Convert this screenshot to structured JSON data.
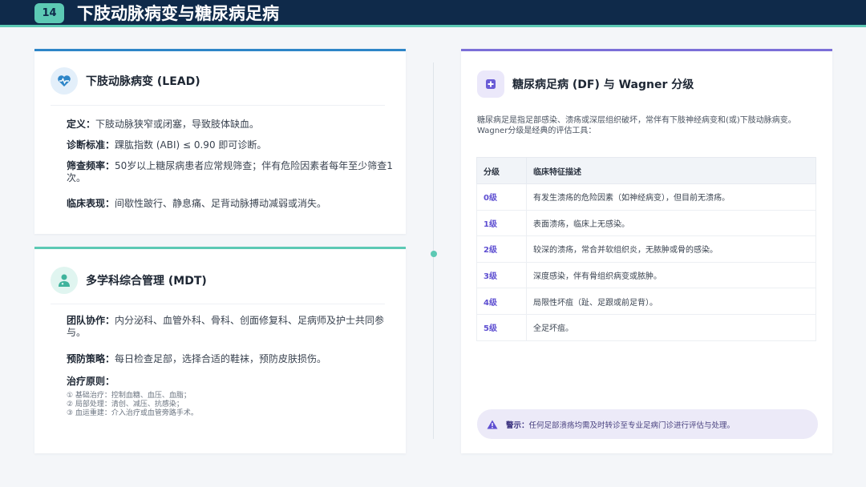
{
  "header": {
    "page_number": "14",
    "title": "下肢动脉病变与糖尿病足病"
  },
  "lead": {
    "title": "下肢动脉病变 (LEAD)",
    "icon": "heartbeat-icon",
    "fields": [
      {
        "label": "定义：",
        "value": "下肢动脉狭窄或闭塞，导致肢体缺血。"
      },
      {
        "label": "诊断标准：",
        "value": "踝肱指数 (ABI) ≤ 0.90 即可诊断。"
      },
      {
        "label": "筛查频率：",
        "value": "50岁以上糖尿病患者应常规筛查；伴有危险因素者每年至少筛查1次。"
      },
      {
        "label": "临床表现：",
        "value": "间歇性跛行、静息痛、足背动脉搏动减弱或消失。"
      }
    ]
  },
  "mdt": {
    "title": "多学科综合管理 (MDT)",
    "icon": "doctor-icon",
    "fields": [
      {
        "label": "团队协作：",
        "value": "内分泌科、血管外科、骨科、创面修复科、足病师及护士共同参与。"
      },
      {
        "label": "预防策略：",
        "value": "每日检查足部，选择合适的鞋袜，预防皮肤损伤。"
      }
    ],
    "principles_label": "治疗原则：",
    "principles": [
      "① 基础治疗：控制血糖、血压、血脂；",
      "② 局部处理：清创、减压、抗感染；",
      "③ 血运重建：介入治疗或血管旁路手术。"
    ]
  },
  "df": {
    "title": "糖尿病足病 (DF) 与 Wagner 分级",
    "icon": "medical-plus-icon",
    "intro": "糖尿病足是指足部感染、溃疡或深层组织破坏，常伴有下肢神经病变和(或)下肢动脉病变。Wagner分级是经典的评估工具：",
    "table": {
      "headers": [
        "分级",
        "临床特征描述"
      ],
      "rows": [
        {
          "grade": "0级",
          "desc": "有发生溃疡的危险因素（如神经病变），但目前无溃疡。"
        },
        {
          "grade": "1级",
          "desc": "表面溃疡，临床上无感染。"
        },
        {
          "grade": "2级",
          "desc": "较深的溃疡，常合并软组织炎，无脓肿或骨的感染。"
        },
        {
          "grade": "3级",
          "desc": "深度感染，伴有骨组织病变或脓肿。"
        },
        {
          "grade": "4级",
          "desc": "局限性坏疽（趾、足跟或前足背）。"
        },
        {
          "grade": "5级",
          "desc": "全足坏疽。"
        }
      ]
    },
    "alert": {
      "icon": "warning-icon",
      "label": "警示：",
      "text": "任何足部溃疡均需及时转诊至专业足病门诊进行评估与处理。"
    }
  },
  "colors": {
    "header_bg": "#0f2a4a",
    "accent_teal": "#5cc9b4",
    "accent_blue": "#2e86c8",
    "accent_purple": "#7b6fd8"
  }
}
